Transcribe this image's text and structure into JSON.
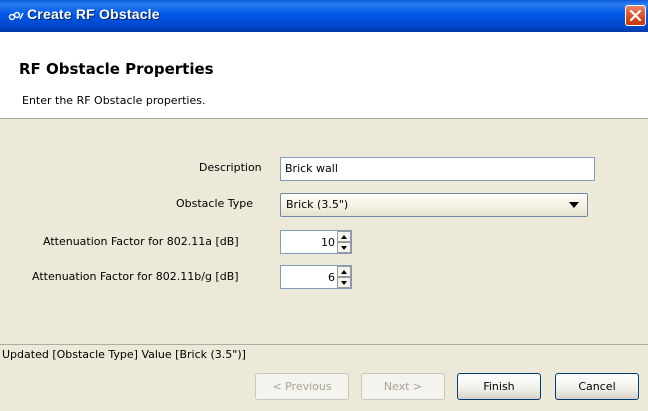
{
  "window": {
    "title": "Create RF Obstacle",
    "icon": "app-logo-icon",
    "icon_text": "ᴳᴼᴸ"
  },
  "header": {
    "title": "RF Obstacle Properties",
    "description": "Enter the RF Obstacle properties."
  },
  "form": {
    "description_label": "Description",
    "description_value": "Brick wall",
    "obstacle_type_label": "Obstacle Type",
    "obstacle_type_value": "Brick (3.5\")",
    "atten_a_label": "Attenuation Factor for 802.11a [dB]",
    "atten_a_value": "10",
    "atten_bg_label": "Attenuation Factor for 802.11b/g [dB]",
    "atten_bg_value": "6"
  },
  "status": {
    "text": "Updated [Obstacle Type] Value [Brick (3.5\")]"
  },
  "buttons": {
    "previous": "< Previous",
    "next": "Next >",
    "finish": "Finish",
    "cancel": "Cancel"
  },
  "colors": {
    "titlebar": "#0058e6",
    "dialog_bg": "#ece9d8",
    "close_button": "#d9481e"
  }
}
